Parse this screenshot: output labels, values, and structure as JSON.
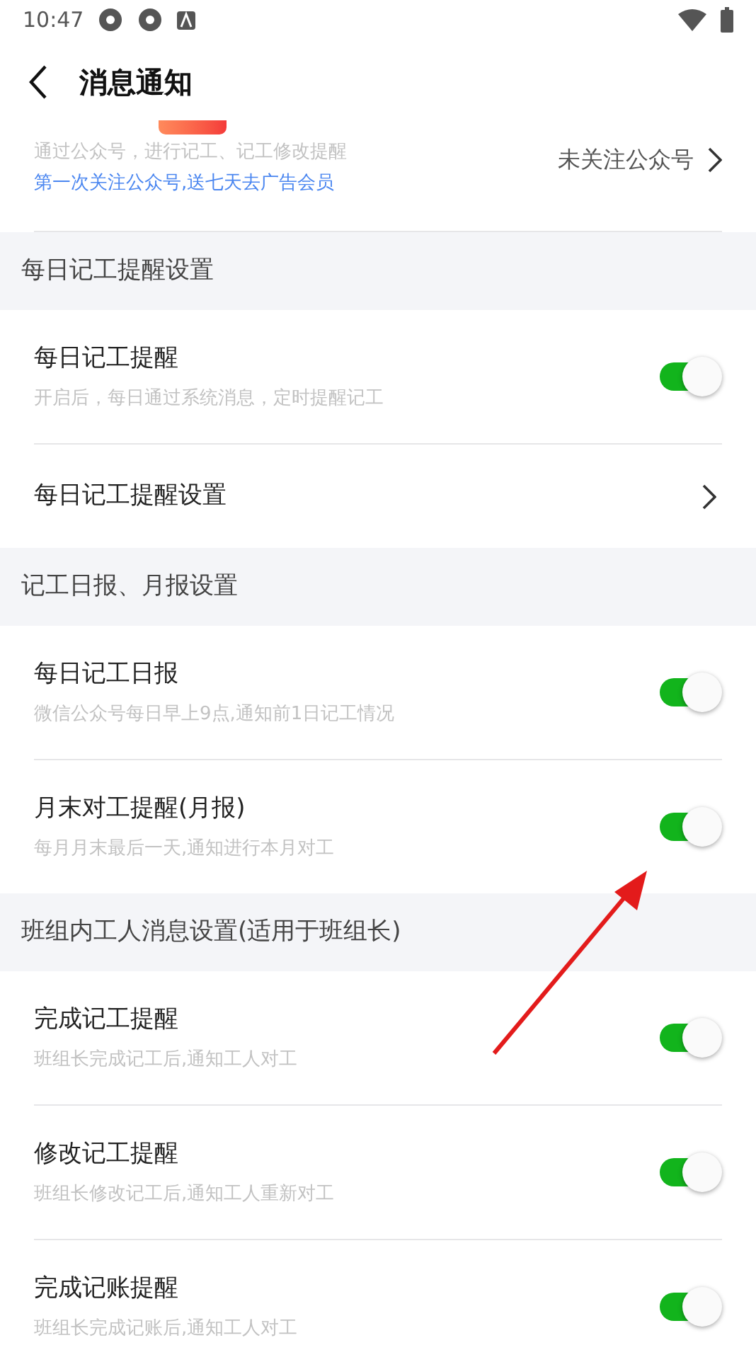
{
  "status_bar": {
    "time": "10:47"
  },
  "header": {
    "title": "消息通知"
  },
  "top_row": {
    "description": "通过公众号，进行记工、记工修改提醒",
    "promo": "第一次关注公众号,送七天去广告会员",
    "value": "未关注公众号"
  },
  "sections": [
    {
      "title": "每日记工提醒设置",
      "items": [
        {
          "kind": "toggle",
          "label": "每日记工提醒",
          "description": "开启后，每日通过系统消息，定时提醒记工",
          "on": true
        },
        {
          "kind": "link",
          "label": "每日记工提醒设置"
        }
      ]
    },
    {
      "title": "记工日报、月报设置",
      "items": [
        {
          "kind": "toggle",
          "label": "每日记工日报",
          "description": "微信公众号每日早上9点,通知前1日记工情况",
          "on": true
        },
        {
          "kind": "toggle",
          "label": "月末对工提醒(月报)",
          "description": "每月月末最后一天,通知进行本月对工",
          "on": true
        }
      ]
    },
    {
      "title": "班组内工人消息设置(适用于班组长)",
      "items": [
        {
          "kind": "toggle",
          "label": "完成记工提醒",
          "description": "班组长完成记工后,通知工人对工",
          "on": true
        },
        {
          "kind": "toggle",
          "label": "修改记工提醒",
          "description": "班组长修改记工后,通知工人重新对工",
          "on": true
        },
        {
          "kind": "toggle",
          "label": "完成记账提醒",
          "description": "班组长完成记账后,通知工人对工",
          "on": true
        }
      ]
    }
  ]
}
